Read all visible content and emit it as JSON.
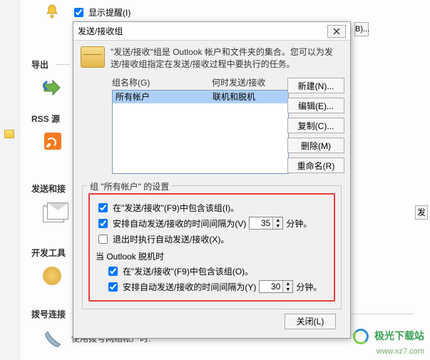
{
  "bg": {
    "show_reminder": "显示提醒(I)",
    "export": "导出",
    "rss": "RSS 源",
    "send_recv": "发送和接",
    "dev_tools": "开发工具",
    "dial": "拨号连接",
    "dial_sub": "使用拨号网络帐户时:",
    "side_btn": "发",
    "partial_b": "B)..."
  },
  "dialog": {
    "title": "发送/接收组",
    "desc": "\"发送/接收\"组是 Outlook 帐户和文件夹的集合。您可以为发送/接收组指定在发送/接收过程中要执行的任务。",
    "col_name": "组名称(G)",
    "col_when": "何时发送/接收",
    "row_name": "所有帐户",
    "row_when": "联机和脱机",
    "buttons": {
      "new": "新建(N)...",
      "edit": "编辑(E)...",
      "copy": "复制(C)...",
      "remove": "删除(M)",
      "rename": "重命名(R)"
    },
    "group_title": "组 \"所有帐户\" 的设置",
    "include_online": "在\"发送/接收\"(F9)中包含该组(I)。",
    "schedule_online": "安排自动发送/接收的时间间隔为(V)",
    "minutes": "分钟。",
    "on_exit": "退出时执行自动发送/接收(X)。",
    "offline_label": "当 Outlook 脱机时",
    "include_offline": "在\"发送/接收\"(F9)中包含该组(O)。",
    "schedule_offline": "安排自动发送/接收的时间间隔为(Y)",
    "interval_online": "35",
    "interval_offline": "30",
    "close": "关闭(L)"
  },
  "watermark": {
    "name": "极光下载站",
    "url": "www.xz7.com"
  }
}
